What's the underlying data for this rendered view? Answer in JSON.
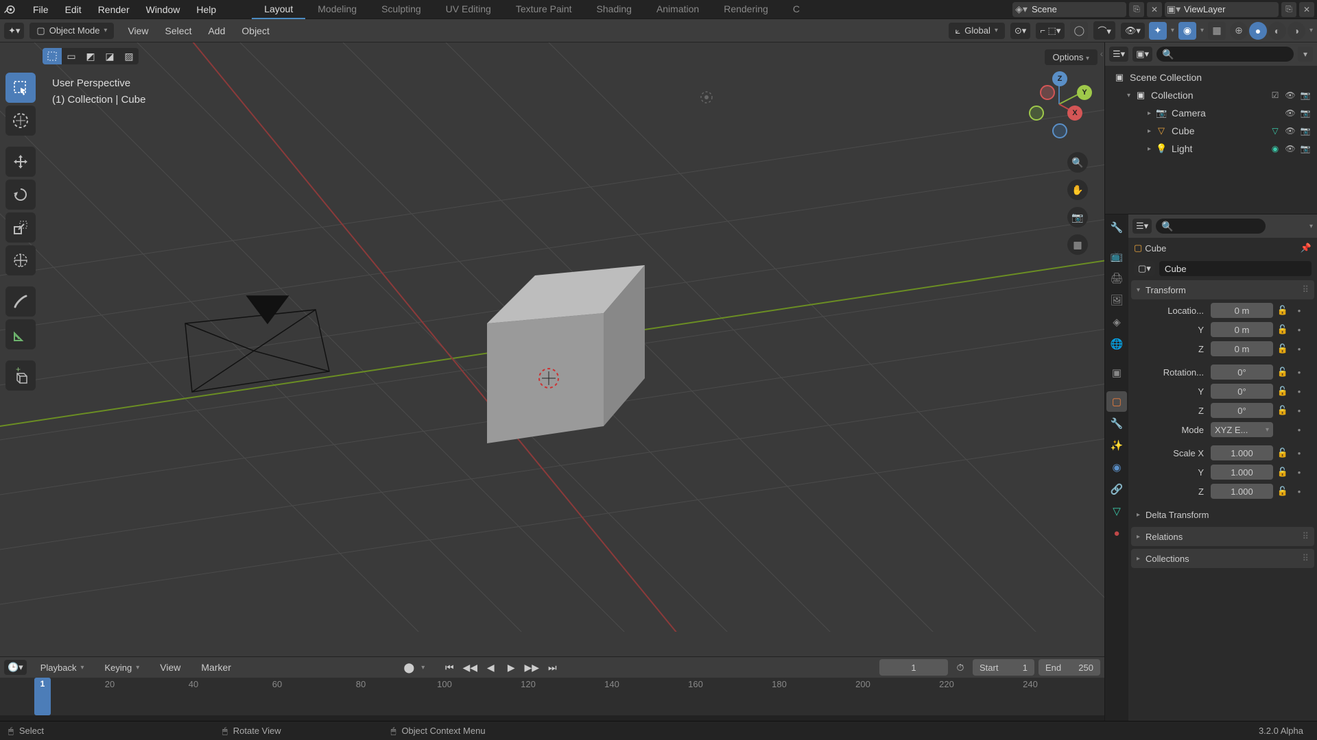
{
  "topmenu": {
    "file": "File",
    "edit": "Edit",
    "render": "Render",
    "window": "Window",
    "help": "Help"
  },
  "workspaces": {
    "layout": "Layout",
    "modeling": "Modeling",
    "sculpting": "Sculpting",
    "uv": "UV Editing",
    "texpaint": "Texture Paint",
    "shading": "Shading",
    "animation": "Animation",
    "rendering": "Rendering",
    "more": "C"
  },
  "scene_name": "Scene",
  "viewlayer_name": "ViewLayer",
  "mode": "Object Mode",
  "header_menu": {
    "view": "View",
    "select": "Select",
    "add": "Add",
    "object": "Object"
  },
  "orientation": "Global",
  "options_label": "Options",
  "view_info": {
    "line1": "User Perspective",
    "line2": "(1) Collection | Cube"
  },
  "axes": {
    "x": "X",
    "y": "Y",
    "z": "Z"
  },
  "outliner": {
    "root": "Scene Collection",
    "coll": "Collection",
    "camera": "Camera",
    "cube": "Cube",
    "light": "Light"
  },
  "props": {
    "breadcrumb_obj": "Cube",
    "datablock": "Cube",
    "panels": {
      "transform": "Transform",
      "delta": "Delta Transform",
      "relations": "Relations",
      "collections": "Collections"
    },
    "labels": {
      "location": "Locatio...",
      "y": "Y",
      "z": "Z",
      "rotation": "Rotation...",
      "mode": "Mode",
      "scalex": "Scale X"
    },
    "loc": {
      "x": "0 m",
      "y": "0 m",
      "z": "0 m"
    },
    "rot": {
      "x": "0°",
      "y": "0°",
      "z": "0°"
    },
    "rotmode": "XYZ E...",
    "scale": {
      "x": "1.000",
      "y": "1.000",
      "z": "1.000"
    }
  },
  "timeline": {
    "menu": {
      "playback": "Playback",
      "keying": "Keying",
      "view": "View",
      "marker": "Marker"
    },
    "current": "1",
    "start_label": "Start",
    "start": "1",
    "end_label": "End",
    "end": "250",
    "ticks": [
      "1",
      "20",
      "40",
      "60",
      "80",
      "100",
      "120",
      "140",
      "160",
      "180",
      "200",
      "220",
      "240"
    ],
    "playhead": "1"
  },
  "status": {
    "select": "Select",
    "rotate": "Rotate View",
    "context": "Object Context Menu",
    "version": "3.2.0 Alpha"
  }
}
